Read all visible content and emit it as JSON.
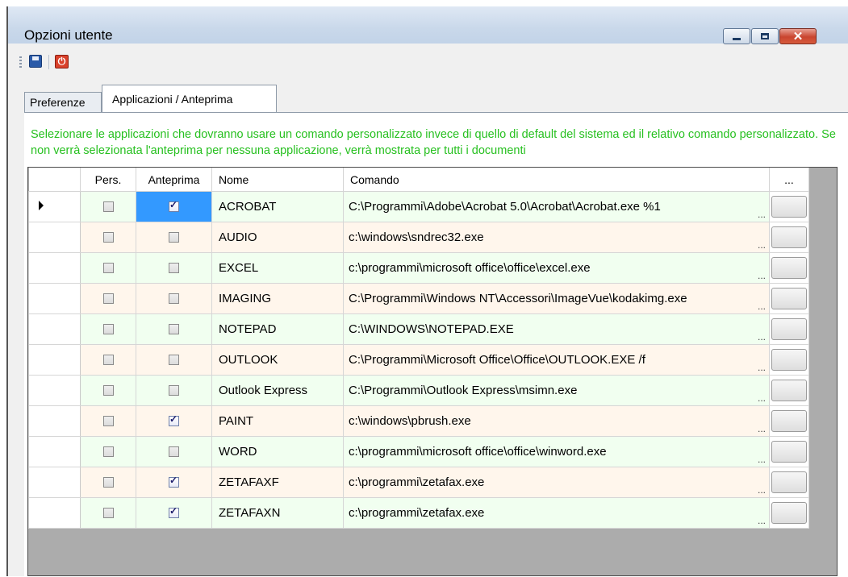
{
  "window": {
    "title": "Opzioni utente"
  },
  "toolbar": {
    "save_icon": "save-icon",
    "exit_icon": "power-icon"
  },
  "tabs": [
    {
      "label": "Preferenze"
    },
    {
      "label": "Applicazioni / Anteprima"
    }
  ],
  "info": "Selezionare le applicazioni che dovranno usare un comando personalizzato invece di quello di default del sistema ed il relativo comando personalizzato. Se non verrà selezionata l'anteprima per nessuna applicazione, verrà mostrata per tutti i documenti",
  "grid": {
    "columns": {
      "pers": "Pers.",
      "anteprima": "Anteprima",
      "nome": "Nome",
      "comando": "Comando",
      "btn": "..."
    },
    "ellipsis": "...",
    "rows": [
      {
        "pers": false,
        "anteprima": true,
        "nome": "ACROBAT",
        "comando": "C:\\Programmi\\Adobe\\Acrobat 5.0\\Acrobat\\Acrobat.exe %1"
      },
      {
        "pers": false,
        "anteprima": false,
        "nome": "AUDIO",
        "comando": "c:\\windows\\sndrec32.exe"
      },
      {
        "pers": false,
        "anteprima": false,
        "nome": "EXCEL",
        "comando": "c:\\programmi\\microsoft office\\office\\excel.exe"
      },
      {
        "pers": false,
        "anteprima": false,
        "nome": "IMAGING",
        "comando": "C:\\Programmi\\Windows NT\\Accessori\\ImageVue\\kodakimg.exe"
      },
      {
        "pers": false,
        "anteprima": false,
        "nome": "NOTEPAD",
        "comando": "C:\\WINDOWS\\NOTEPAD.EXE"
      },
      {
        "pers": false,
        "anteprima": false,
        "nome": "OUTLOOK",
        "comando": "C:\\Programmi\\Microsoft Office\\Office\\OUTLOOK.EXE /f"
      },
      {
        "pers": false,
        "anteprima": false,
        "nome": "Outlook Express",
        "comando": "C:\\Programmi\\Outlook Express\\msimn.exe"
      },
      {
        "pers": false,
        "anteprima": true,
        "nome": "PAINT",
        "comando": "c:\\windows\\pbrush.exe"
      },
      {
        "pers": false,
        "anteprima": false,
        "nome": "WORD",
        "comando": "c:\\programmi\\microsoft office\\office\\winword.exe"
      },
      {
        "pers": false,
        "anteprima": true,
        "nome": "ZETAFAXF",
        "comando": "c:\\programmi\\zetafax.exe"
      },
      {
        "pers": false,
        "anteprima": true,
        "nome": "ZETAFAXN",
        "comando": "c:\\programmi\\zetafax.exe"
      }
    ]
  }
}
